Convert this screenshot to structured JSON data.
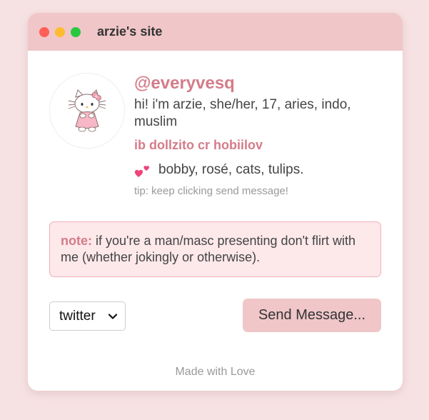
{
  "window": {
    "title": "arzie's site",
    "controls": [
      "close",
      "minimize",
      "zoom"
    ]
  },
  "profile": {
    "avatar_icon": "hello-kitty-icon",
    "handle": "@everyvesq",
    "bio": "hi! i'm arzie, she/her, 17, aries, indo, muslim",
    "tagline": "ib dollzito cr hobiilov",
    "likes_icon": "two-hearts-icon",
    "likes": "bobby, rosé, cats, tulips.",
    "tip": "tip: keep clicking send message!"
  },
  "note": {
    "label": "note:",
    "text": " if you're a man/masc presenting don't flirt with me (whether jokingly or otherwise)."
  },
  "platform_select": {
    "selected": "twitter"
  },
  "send_button": {
    "label": "Send Message..."
  },
  "footer": {
    "text": "Made with Love"
  },
  "colors": {
    "page_bg": "#f7e2e3",
    "titlebar": "#f0c6c8",
    "accent": "#d47c89",
    "note_bg": "#fde8ea",
    "note_border": "#eeb0b8"
  }
}
